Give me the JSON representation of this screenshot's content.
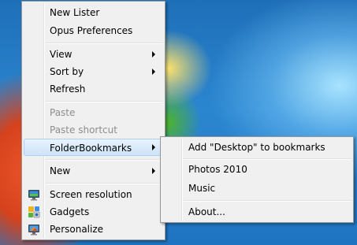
{
  "main_menu": {
    "items": [
      {
        "label": "New Lister"
      },
      {
        "label": "Opus Preferences"
      },
      {
        "label": "View"
      },
      {
        "label": "Sort by"
      },
      {
        "label": "Refresh"
      },
      {
        "label": "Paste"
      },
      {
        "label": "Paste shortcut"
      },
      {
        "label": "FolderBookmarks"
      },
      {
        "label": "New"
      },
      {
        "label": "Screen resolution",
        "icon": "monitor-icon"
      },
      {
        "label": "Gadgets",
        "icon": "gadgets-icon"
      },
      {
        "label": "Personalize",
        "icon": "personalize-icon"
      }
    ]
  },
  "submenu": {
    "items": [
      {
        "label": "Add \"Desktop\" to bookmarks"
      },
      {
        "label": "Photos 2010"
      },
      {
        "label": "Music"
      },
      {
        "label": "About..."
      }
    ]
  },
  "colors": {
    "menu_bg": "#f0f0f0",
    "highlight": "#d9ebfa",
    "disabled_text": "#8d8d8d"
  }
}
